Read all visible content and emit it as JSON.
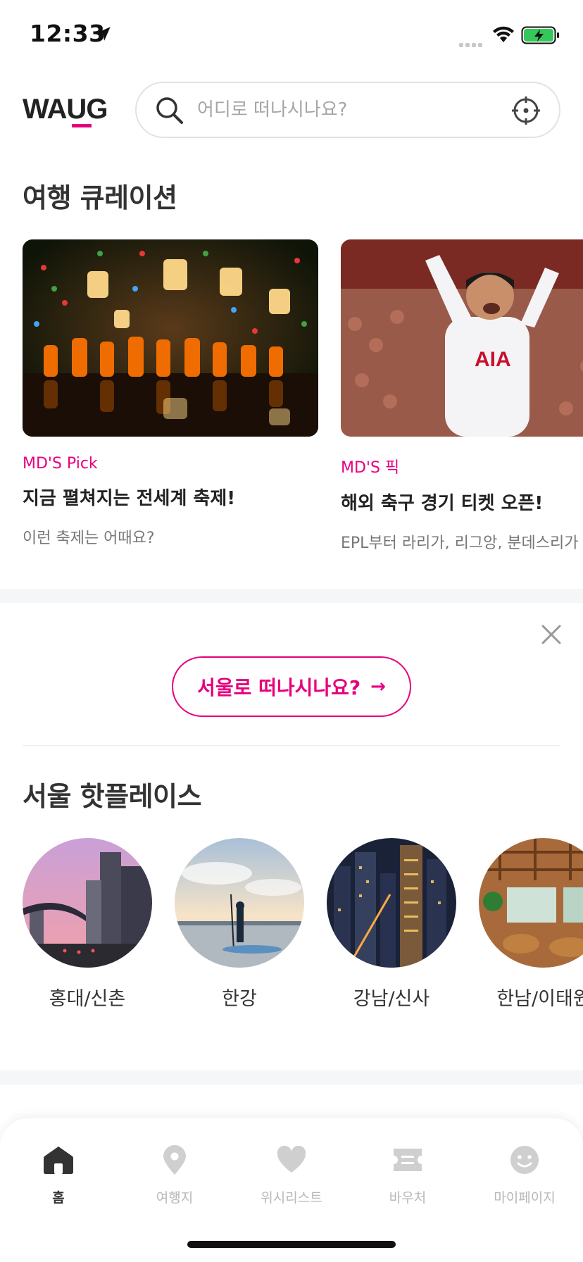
{
  "status_bar": {
    "time": "12:33"
  },
  "header": {
    "logo_text": "WAUG",
    "brand_color": "#e6007e",
    "search": {
      "placeholder": "어디로 떠나시나요?",
      "value": ""
    }
  },
  "curation": {
    "title": "여행 큐레이션",
    "cards": [
      {
        "tag": "MD'S Pick",
        "title": "지금 펼쳐지는 전세계 축제!",
        "desc": "이런 축제는 어때요?",
        "image": "lantern-festival-photo"
      },
      {
        "tag": "MD'S 픽",
        "title": "해외 축구 경기 티켓 오픈!",
        "desc": "EPL부터 라리가, 리그앙, 분데스리가",
        "image": "football-player-celebration-photo"
      }
    ]
  },
  "seoul_banner": {
    "cta_label": "서울로 떠나시나요?",
    "cta_arrow": "→"
  },
  "hotplaces": {
    "title": "서울 핫플레이스",
    "items": [
      {
        "label": "홍대/신촌",
        "image": "city-street-sunset-photo"
      },
      {
        "label": "한강",
        "image": "river-paddleboard-photo"
      },
      {
        "label": "강남/신사",
        "image": "night-skyline-photo"
      },
      {
        "label": "한남/이태원",
        "image": "cafe-interior-photo"
      }
    ]
  },
  "bottom_nav": {
    "items": [
      {
        "label": "홈",
        "icon": "home-icon",
        "active": true
      },
      {
        "label": "여행지",
        "icon": "map-pin-icon",
        "active": false
      },
      {
        "label": "위시리스트",
        "icon": "heart-icon",
        "active": false
      },
      {
        "label": "바우처",
        "icon": "ticket-icon",
        "active": false
      },
      {
        "label": "마이페이지",
        "icon": "smiley-icon",
        "active": false
      }
    ]
  }
}
